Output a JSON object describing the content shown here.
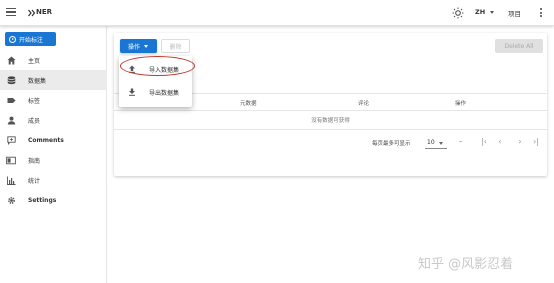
{
  "app": {
    "brand": "NER",
    "lang": "ZH",
    "project": "项目"
  },
  "sidebar": {
    "start_label": "开始标注",
    "items": [
      {
        "label": "主页",
        "icon": "home-icon"
      },
      {
        "label": "数据集",
        "icon": "database-icon",
        "active": true
      },
      {
        "label": "标签",
        "icon": "label-icon"
      },
      {
        "label": "成员",
        "icon": "person-icon"
      },
      {
        "label": "Comments",
        "icon": "comment-icon"
      },
      {
        "label": "指南",
        "icon": "guide-icon"
      },
      {
        "label": "统计",
        "icon": "chart-icon"
      },
      {
        "label": "Settings",
        "icon": "gear-icon"
      }
    ]
  },
  "toolbar": {
    "actions_label": "操作",
    "delete_label": "删除",
    "delete_all_label": "Delete All"
  },
  "menu": {
    "items": [
      {
        "label": "导入数据集",
        "icon": "upload-icon"
      },
      {
        "label": "导出数据集",
        "icon": "download-icon"
      }
    ]
  },
  "table": {
    "columns": [
      "元数据",
      "评论",
      "操作"
    ],
    "empty_text": "没有数据可获得"
  },
  "pagination": {
    "rows_label": "每页最多可显示",
    "rows_value": "10",
    "range": "–"
  },
  "watermark": "知乎 @风影忍着",
  "colors": {
    "primary": "#1976d2",
    "highlight": "#c0392b"
  }
}
